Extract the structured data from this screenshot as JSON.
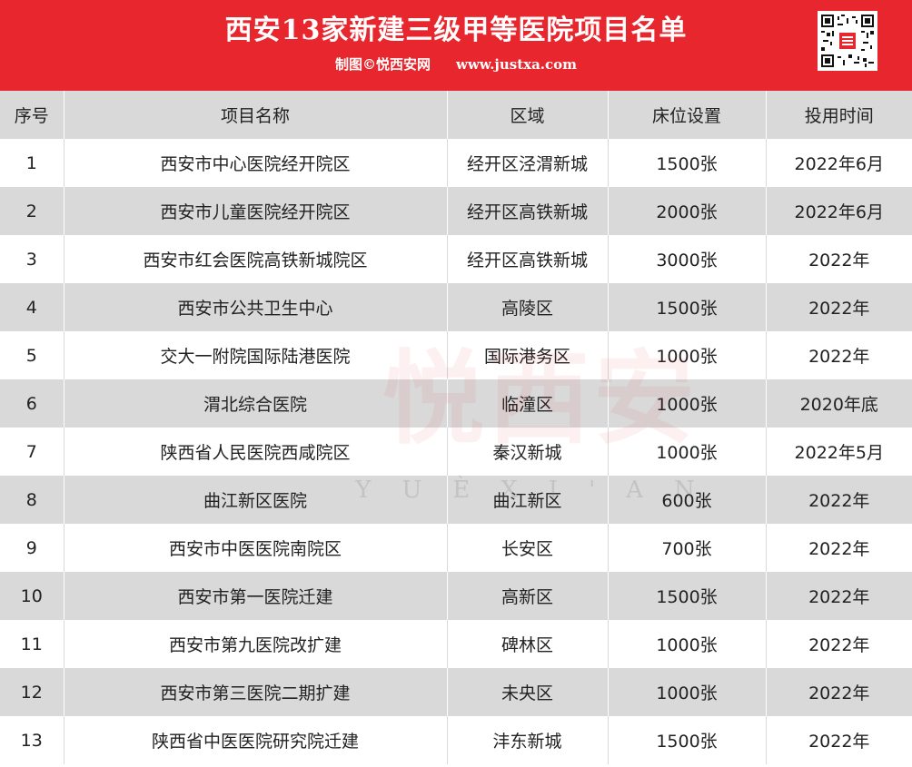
{
  "banner": {
    "title": "西安13家新建三级甲等医院项目名单",
    "credit": "制图©悦西安网",
    "site": "www.justxa.com",
    "background_color": "#e8262d",
    "qr_icon": "qr-code-icon"
  },
  "table": {
    "headers": [
      "序号",
      "项目名称",
      "区域",
      "床位设置",
      "投用时间"
    ],
    "rows": [
      [
        "1",
        "西安市中心医院经开院区",
        "经开区泾渭新城",
        "1500张",
        "2022年6月"
      ],
      [
        "2",
        "西安市儿童医院经开院区",
        "经开区高铁新城",
        "2000张",
        "2022年6月"
      ],
      [
        "3",
        "西安市红会医院高铁新城院区",
        "经开区高铁新城",
        "3000张",
        "2022年"
      ],
      [
        "4",
        "西安市公共卫生中心",
        "高陵区",
        "1500张",
        "2022年"
      ],
      [
        "5",
        "交大一附院国际陆港医院",
        "国际港务区",
        "1000张",
        "2022年"
      ],
      [
        "6",
        "渭北综合医院",
        "临潼区",
        "1000张",
        "2020年底"
      ],
      [
        "7",
        "陕西省人民医院西咸院区",
        "秦汉新城",
        "1000张",
        "2022年5月"
      ],
      [
        "8",
        "曲江新区医院",
        "曲江新区",
        "600张",
        "2022年"
      ],
      [
        "9",
        "西安市中医医院南院区",
        "长安区",
        "700张",
        "2022年"
      ],
      [
        "10",
        "西安市第一医院迁建",
        "高新区",
        "1500张",
        "2022年"
      ],
      [
        "11",
        "西安市第九医院改扩建",
        "碑林区",
        "1000张",
        "2022年"
      ],
      [
        "12",
        "西安市第三医院二期扩建",
        "未央区",
        "1000张",
        "2022年"
      ],
      [
        "13",
        "陕西省中医医院研究院迁建",
        "沣东新城",
        "1500张",
        "2022年"
      ]
    ]
  },
  "watermark": {
    "text": "悦西安",
    "pinyin": "YUÈXI'AN"
  }
}
